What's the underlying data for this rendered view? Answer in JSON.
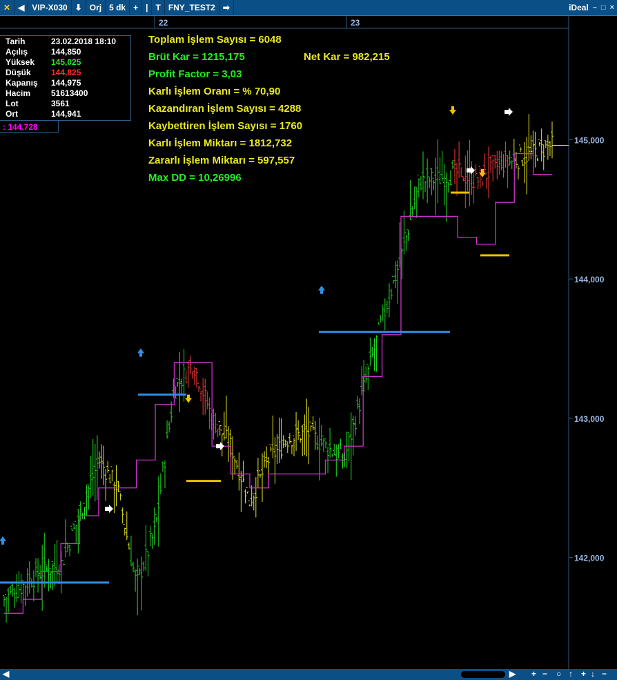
{
  "toolbar": {
    "symbol": "VIP-X030",
    "mode": "Orj",
    "period": "5 dk",
    "strategy": "FNY_TEST2",
    "brand": "iDeal"
  },
  "colors": {
    "green_bar": "#22dd22",
    "yellow_bar": "#e8e820",
    "red_bar": "#ff3b3b",
    "stop_line": "#cc33cc",
    "buy_level": "#2f8fe8",
    "sell_level": "#f0c000",
    "axis_text": "#9ab7e0"
  },
  "info": {
    "rows": [
      {
        "label": "Tarih",
        "value": "23.02.2018 18:10",
        "color": "#ffffff"
      },
      {
        "label": "Açılış",
        "value": "144,850",
        "color": "#ffffff"
      },
      {
        "label": "Yüksek",
        "value": "145,025",
        "color": "#22ee22"
      },
      {
        "label": "Düşük",
        "value": "144,825",
        "color": "#ff3030"
      },
      {
        "label": "Kapanış",
        "value": "144,975",
        "color": "#ffffff"
      },
      {
        "label": "Hacim",
        "value": "51613400",
        "color": "#ffffff"
      },
      {
        "label": "Lot",
        "value": "3561",
        "color": "#ffffff"
      },
      {
        "label": "Ort",
        "value": "144,941",
        "color": "#ffffff"
      }
    ],
    "cursor_value": ": 144,728"
  },
  "stats": {
    "total_trades": "Toplam İşlem Sayısı =  6048",
    "gross_profit": "Brüt Kar =  1215,175",
    "net_profit": "Net Kar =  982,215",
    "profit_factor": "Profit Factor =  3,03",
    "win_rate": "Karlı İşlem Oranı = % 70,90",
    "winning_trades": "Kazandıran İşlem Sayısı =  4288",
    "losing_trades": "Kaybettiren İşlem Sayısı =  1760",
    "win_amount": "Karlı İşlem Miktarı =  1812,732",
    "loss_amount": "Zararlı İşlem Miktarı =  597,557",
    "max_dd": "Max DD = 10,26996"
  },
  "chart_data": {
    "type": "line",
    "title": "",
    "date_labels": [
      "22",
      "23"
    ],
    "y_ticks": [
      "142,000",
      "143,000",
      "144,000",
      "145,000"
    ],
    "ylim": [
      141200,
      145800
    ],
    "price_path": [
      141700,
      141800,
      141900,
      141950,
      142300,
      142700,
      142500,
      141800,
      142200,
      143200,
      143400,
      143000,
      142800,
      142400,
      142700,
      142850,
      142900,
      142800,
      142700,
      143200,
      143700,
      144150,
      144700,
      144720,
      144760,
      144700,
      144800,
      144850,
      144900,
      144960
    ],
    "stop_path": [
      141600,
      141700,
      141900,
      142100,
      142300,
      142500,
      142500,
      142700,
      143100,
      143400,
      143400,
      142800,
      142600,
      142500,
      142600,
      142600,
      142600,
      142700,
      142800,
      143300,
      143600,
      144450,
      144450,
      144450,
      144300,
      144250,
      144550,
      144900,
      144750,
      144750
    ],
    "buy_levels": [
      141820,
      143170,
      143620
    ],
    "sell_levels": [
      142550,
      144620,
      144170
    ]
  }
}
